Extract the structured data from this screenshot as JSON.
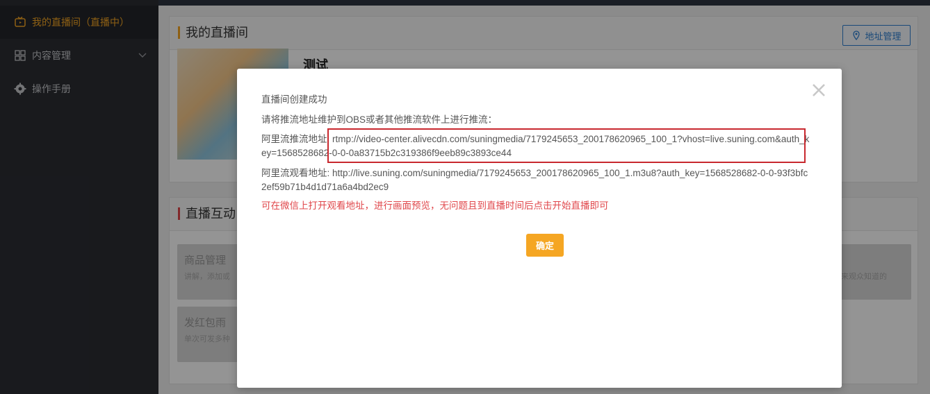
{
  "sidebar": {
    "items": [
      {
        "label": "我的直播间（直播中）",
        "icon": "tv-icon",
        "active": true
      },
      {
        "label": "内容管理",
        "icon": "grid-icon",
        "expandable": true
      },
      {
        "label": "操作手册",
        "icon": "gear-icon"
      }
    ]
  },
  "main": {
    "room_panel": {
      "title": "我的直播间",
      "address_button": "地址管理",
      "room_name": "测试"
    },
    "interact_panel": {
      "title": "直播互动",
      "cards": [
        {
          "title": "商品管理",
          "desc": "讲解，添加或"
        },
        {
          "title": "发红包雨",
          "desc": "单次可发多种"
        }
      ],
      "right_card_desc": "来观众知道的"
    }
  },
  "modal": {
    "title": "直播间创建成功",
    "instruction": "请将推流地址维护到OBS或者其他推流软件上进行推流：",
    "push_label": "阿里流推流地址:",
    "push_url": "rtmp://video-center.alivecdn.com/suningmedia/7179245653_200178620965_100_1?vhost=live.suning.com&auth_key=1568528682-0-0-0a83715b2c319386f9eeb89c3893ce44",
    "watch_label": "阿里流观看地址:",
    "watch_url": "http://live.suning.com/suningmedia/7179245653_200178620965_100_1.m3u8?auth_key=1568528682-0-0-93f3bfc2ef59b71b4d1d71a6a4bd2ec9",
    "warning": "可在微信上打开观看地址，进行画面预览，无问题且到直播时间后点击开始直播即可",
    "confirm_button": "确定"
  },
  "colors": {
    "accent": "#f5a623",
    "sidebar_bg": "#2b2d33",
    "warning_red": "#e0474b",
    "highlight_border": "#c8282e",
    "link_blue": "#2d7fd1"
  }
}
